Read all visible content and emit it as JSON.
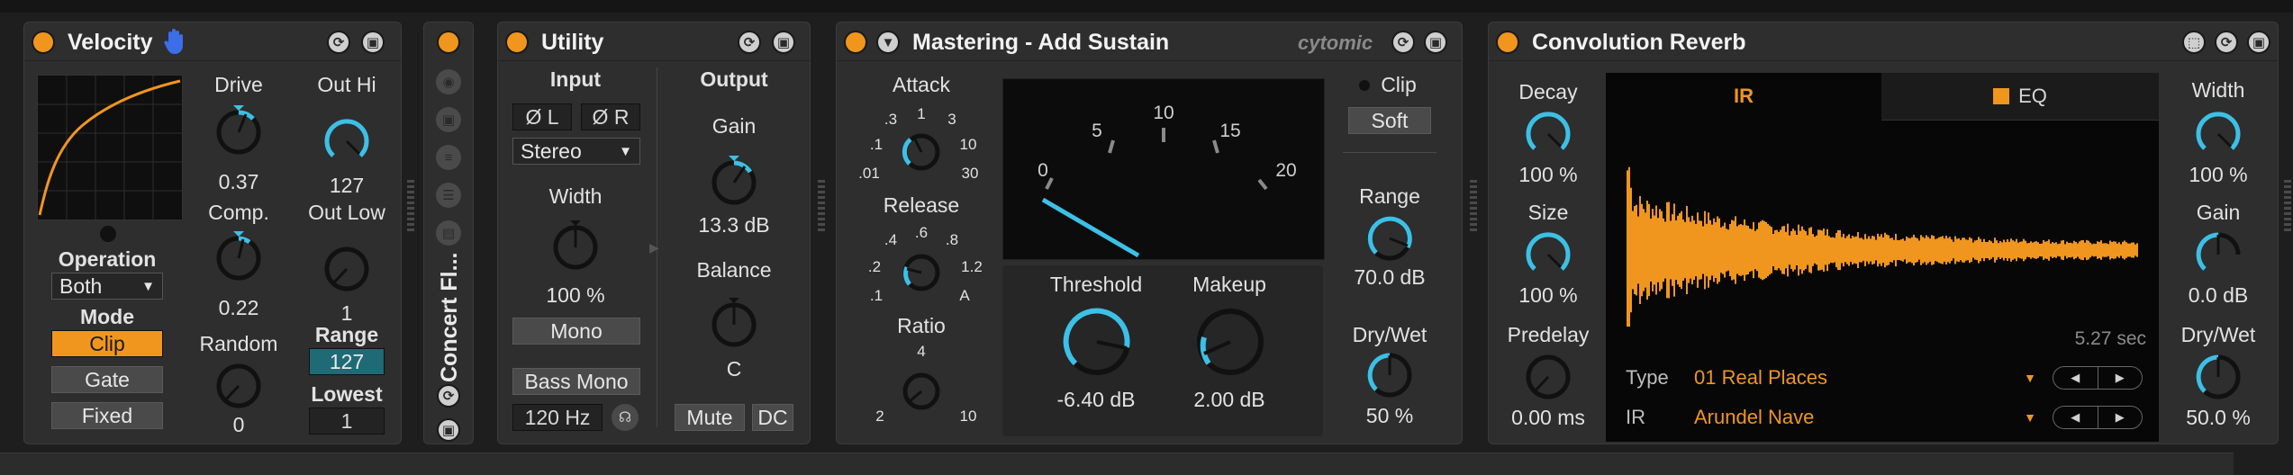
{
  "velocity": {
    "title": "Velocity",
    "drive_label": "Drive",
    "drive_value": "0.37",
    "out_hi_label": "Out Hi",
    "out_hi_value": "127",
    "comp_label": "Comp.",
    "comp_value": "0.22",
    "out_low_label": "Out Low",
    "out_low_value": "1",
    "operation_label": "Operation",
    "operation_value": "Both",
    "mode_label": "Mode",
    "mode_options": [
      "Clip",
      "Gate",
      "Fixed"
    ],
    "random_label": "Random",
    "random_value": "0",
    "range_label": "Range",
    "range_value": "127",
    "lowest_label": "Lowest",
    "lowest_value": "1"
  },
  "rack": {
    "name": "Concert Fl..."
  },
  "utility": {
    "title": "Utility",
    "input_label": "Input",
    "phase_l": "Ø L",
    "phase_r": "Ø R",
    "channel_mode": "Stereo",
    "width_label": "Width",
    "width_value": "100 %",
    "mono_label": "Mono",
    "bass_mono_label": "Bass Mono",
    "bass_mono_freq": "120 Hz",
    "output_label": "Output",
    "gain_label": "Gain",
    "gain_value": "13.3 dB",
    "balance_label": "Balance",
    "balance_value": "C",
    "mute_label": "Mute",
    "dc_label": "DC"
  },
  "mastering": {
    "title": "Mastering - Add Sustain",
    "brand": "cytomic",
    "attack_label": "Attack",
    "attack_ticks": [
      ".01",
      ".1",
      ".3",
      "1",
      "3",
      "10",
      "30"
    ],
    "release_label": "Release",
    "release_ticks": [
      ".1",
      ".2",
      ".4",
      ".6",
      ".8",
      "1.2",
      "A"
    ],
    "ratio_label": "Ratio",
    "ratio_ticks": [
      "2",
      "4",
      "10"
    ],
    "meter_ticks": [
      "0",
      "5",
      "10",
      "15",
      "20"
    ],
    "threshold_label": "Threshold",
    "threshold_value": "-6.40 dB",
    "makeup_label": "Makeup",
    "makeup_value": "2.00 dB",
    "clip_label": "Clip",
    "clip_mode": "Soft",
    "range_label": "Range",
    "range_value": "70.0 dB",
    "drywet_label": "Dry/Wet",
    "drywet_value": "50 %"
  },
  "reverb": {
    "title": "Convolution Reverb",
    "decay_label": "Decay",
    "decay_value": "100 %",
    "size_label": "Size",
    "size_value": "100 %",
    "predelay_label": "Predelay",
    "predelay_value": "0.00 ms",
    "tab_ir": "IR",
    "tab_eq": "EQ",
    "length": "5.27 sec",
    "type_label": "Type",
    "type_value": "01 Real Places",
    "ir_label": "IR",
    "ir_value": "Arundel Nave",
    "width_label": "Width",
    "width_value": "100 %",
    "gain_label": "Gain",
    "gain_value": "0.0 dB",
    "drywet_label": "Dry/Wet",
    "drywet_value": "50.0 %"
  },
  "colors": {
    "accent": "#f0961e",
    "knob_arc": "#3cc0e6",
    "panel": "#2e2e2e"
  }
}
